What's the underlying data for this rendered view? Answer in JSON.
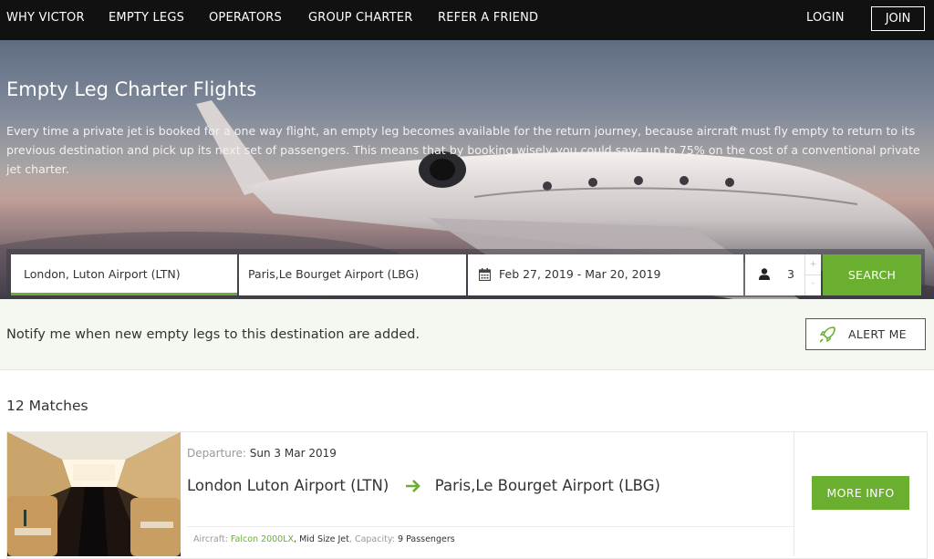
{
  "nav": {
    "items": [
      "WHY VICTOR",
      "EMPTY LEGS",
      "OPERATORS",
      "GROUP CHARTER",
      "REFER A FRIEND"
    ],
    "login": "LOGIN",
    "join": "JOIN"
  },
  "hero": {
    "title": "Empty Leg Charter Flights",
    "description": "Every time a private jet is booked for a one way flight, an empty leg becomes available for the return journey, because aircraft must fly empty to return to its previous destination and pick up its next set of passengers. This means that by booking wisely you could save up to 75% on the cost of a conventional private jet charter."
  },
  "search": {
    "from": "London, Luton Airport (LTN)",
    "to": "Paris,Le Bourget Airport (LBG)",
    "dates": "Feb 27, 2019 - Mar 20, 2019",
    "passengers": "3",
    "plus": "+",
    "minus": "-",
    "button": "SEARCH"
  },
  "notify": {
    "text": "Notify me when new empty legs to this destination are added.",
    "button": "ALERT ME"
  },
  "results": {
    "count_label": "12 Matches",
    "items": [
      {
        "departure_label": "Departure:",
        "departure_date": "Sun 3 Mar 2019",
        "origin": "London Luton Airport (LTN)",
        "destination": "Paris,Le Bourget Airport (LBG)",
        "aircraft_label": "Aircraft:",
        "aircraft": "Falcon 2000LX",
        "jet_class": "Mid Size Jet",
        "capacity_label": "Capacity:",
        "capacity": "9 Passengers",
        "button": "MORE INFO"
      }
    ]
  },
  "colors": {
    "accent": "#6aaf2f",
    "nav_bg": "#111111"
  },
  "icons": [
    "calendar-icon",
    "user-icon",
    "rocket-alert-icon",
    "arrow-right-icon"
  ]
}
